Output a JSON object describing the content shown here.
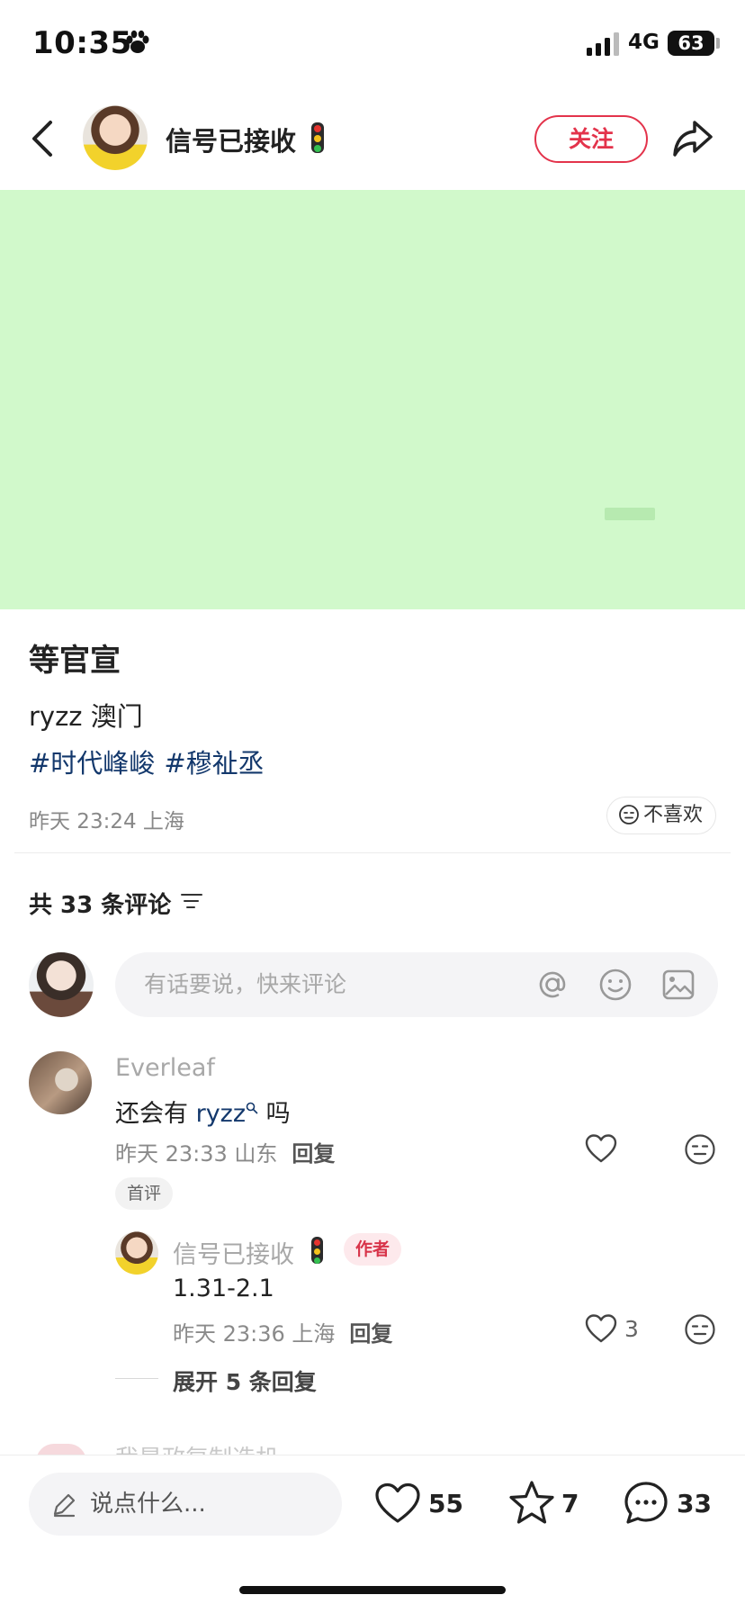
{
  "status": {
    "time": "10:35",
    "network": "4G",
    "battery": "63"
  },
  "header": {
    "username": "信号已接收",
    "follow": "关注"
  },
  "post": {
    "title": "等官宣",
    "text": "ryzz 澳门",
    "tags": [
      "#时代峰峻",
      "#穆祉丞"
    ],
    "meta": "昨天 23:24 上海",
    "dislike": "不喜欢"
  },
  "comments": {
    "count_label": "共 33 条评论",
    "input_placeholder": "有话要说，快来评论",
    "items": [
      {
        "name": "Everleaf",
        "text_before": "还会有 ",
        "mention": "ryzz",
        "text_after": " 吗",
        "meta": "昨天 23:33 山东",
        "reply": "回复",
        "badge": "首评",
        "replies": [
          {
            "name": "信号已接收",
            "badge": "作者",
            "text": "1.31-2.1",
            "meta": "昨天 23:36 上海",
            "reply": "回复",
            "likes": "3"
          }
        ],
        "expand": "展开 5 条回复"
      }
    ],
    "peek_name": "我是政复制造机"
  },
  "bottom": {
    "say_placeholder": "说点什么...",
    "likes": "55",
    "stars": "7",
    "comments": "33"
  },
  "colors": {
    "accent": "#e3334b",
    "tag": "#13386c",
    "image_bg": "#d1f9cb"
  }
}
